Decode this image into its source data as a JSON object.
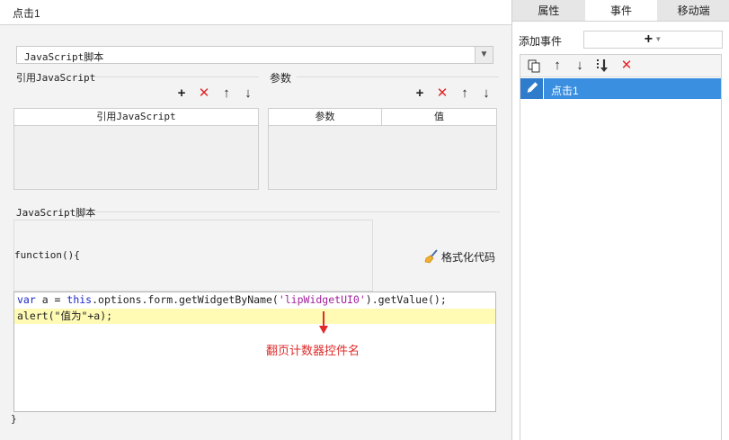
{
  "dialog": {
    "title": "点击1"
  },
  "script_type": {
    "selected": "JavaScript脚本"
  },
  "ref_js": {
    "section_label": "引用JavaScript",
    "column": "引用JavaScript"
  },
  "params": {
    "section_label": "参数",
    "columns": [
      "参数",
      "值"
    ]
  },
  "script": {
    "section_label": "JavaScript脚本",
    "open_line": "function(){",
    "close_line": "}",
    "format_button": "格式化代码",
    "code": {
      "l1_kw1": "var",
      "l1_mid": " a = ",
      "l1_kw2": "this",
      "l1_call": ".options.form.getWidgetByName(",
      "l1_str": "'lipWidgetUI0'",
      "l1_end": ").getValue();",
      "l2": "alert(\"值为\"+a);"
    }
  },
  "annotation": {
    "text": "翻页计数器控件名"
  },
  "right_panel": {
    "tabs": [
      "属性",
      "事件",
      "移动端"
    ],
    "active_tab": "事件",
    "add_event_label": "添加事件",
    "events": [
      "点击1"
    ]
  },
  "colors": {
    "accent": "#3a8fe0",
    "delete": "#e02828",
    "annotation": "#e02a2a",
    "highlight": "#fffbb5"
  }
}
